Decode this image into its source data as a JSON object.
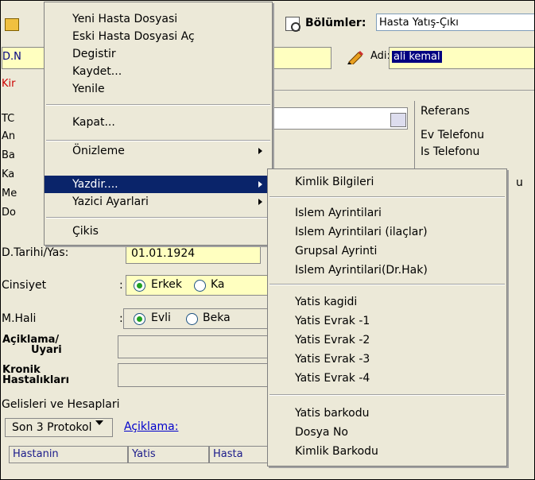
{
  "header": {
    "bolumler_label": "Bölümler:",
    "bolumler_value": "Hasta Yatış-Çıkı"
  },
  "row2": {
    "dno_label": "D.N",
    "adi_label": "Adi:",
    "adi_value": "ali kemal"
  },
  "kir_label": "Kir",
  "left_labels": [
    "TC",
    "An",
    "Ba",
    "Ka",
    "Me",
    "Do"
  ],
  "referans": {
    "items": [
      "Referans",
      "Ev Telefonu",
      "Is Telefonu"
    ],
    "partial": "u"
  },
  "form": {
    "dtarih_label": "D.Tarihi/Yas:",
    "dtarih_value": "01.01.1924",
    "cinsiyet_label": "Cinsiyet",
    "cinsiyet_colon": ":",
    "cinsiyet_options": [
      "Erkek",
      "Ka"
    ],
    "mhali_label": "M.Hali",
    "mhali_colon": ":",
    "mhali_options": [
      "Evli",
      "Beka"
    ],
    "aciklama_label_1": "Açiklama/",
    "aciklama_label_2": "Uyari",
    "kronik_label_1": "Kronik",
    "kronik_label_2": "Hastalıkları"
  },
  "gelisler": {
    "label": "Gelisleri ve Hesaplari",
    "combo_value": "Son 3 Protokol",
    "aciklama_link": "Açiklama:"
  },
  "table": {
    "headers": [
      "Hastanin",
      "Yatis",
      "Hasta"
    ]
  },
  "main_menu": {
    "items": [
      {
        "label": "Yeni  Hasta Dosyasi",
        "submenu": false
      },
      {
        "label": "Eski Hasta Dosyasi Aç",
        "submenu": false
      },
      {
        "label": "Degistir",
        "submenu": false
      },
      {
        "label": "Kaydet...",
        "submenu": false
      },
      {
        "label": "Yenile",
        "submenu": false
      },
      {
        "label": "Kapat...",
        "submenu": false
      },
      {
        "label": "Önizleme",
        "submenu": true
      },
      {
        "label": "Yazdir....",
        "submenu": true,
        "selected": true
      },
      {
        "label": "Yazici Ayarlari",
        "submenu": true
      },
      {
        "label": "Çikis",
        "submenu": false
      }
    ]
  },
  "sub_menu": {
    "items": [
      "Kimlik Bilgileri",
      "Islem Ayrintilari",
      "Islem Ayrintilari (ilaçlar)",
      "Grupsal Ayrinti",
      "Islem Ayrintilari(Dr.Hak)",
      "Yatis kagidi",
      "Yatis Evrak -1",
      "Yatis Evrak -2",
      "Yatis Evrak -3",
      "Yatis Evrak -4",
      "Yatis barkodu",
      "Dosya No",
      "Kimlik Barkodu"
    ]
  },
  "colors": {
    "menu_highlight": "#0a246a",
    "field_yellow": "#ffffc0",
    "window_bg": "#ece9d8",
    "radio_dot": "#21a121"
  }
}
